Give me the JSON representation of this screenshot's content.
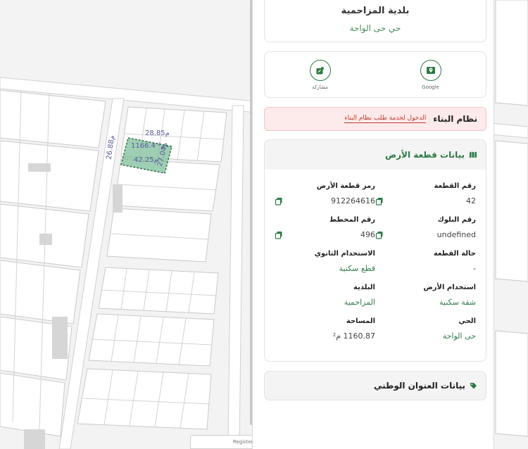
{
  "municipality": {
    "title": "بلدية المزاحمية",
    "district": "حي حى الواحة"
  },
  "actions": [
    {
      "label": "Google",
      "icon": "map-pin-icon"
    },
    {
      "label": "مشاركة",
      "icon": "share-icon"
    }
  ],
  "building_system": {
    "title": "نظام البناء",
    "link": "الدخول لخدمة طلب نظام البناء"
  },
  "land": {
    "title": "بيانات قطعة الأرض",
    "fields": [
      {
        "label": "رقم القطعة",
        "value": "42",
        "copy": true
      },
      {
        "label": "رمز قطعة الأرض",
        "value": "912264616",
        "copy": true
      },
      {
        "label": "رقم البلوك",
        "value": "undefined",
        "copy": true
      },
      {
        "label": "رقم المخطط",
        "value": "496",
        "copy": true
      },
      {
        "label": "حالة القطعة",
        "value": "-",
        "copy": false
      },
      {
        "label": "الاستخدام الثانوي",
        "value": "قطع سكنية",
        "copy": false
      },
      {
        "label": "استخدام الأرض",
        "value": "شقة سكنية",
        "copy": false
      },
      {
        "label": "البلدية",
        "value": "المزاحمية",
        "copy": false
      },
      {
        "label": "الحي",
        "value": "حى الواحة",
        "copy": false
      },
      {
        "label": "المساحة",
        "value": "1160.87 م²",
        "copy": false
      }
    ]
  },
  "national_address": {
    "title": "بيانات العنوان الوطني"
  },
  "map": {
    "dims": {
      "top": "28.85م",
      "left": "26.88م",
      "bottom": "42.25م",
      "right": "27.04م",
      "area": "1166.4 م²"
    },
    "scale_label": "Registered on"
  },
  "colors": {
    "accent": "#2c7a44",
    "parcel": "#7fbf9a"
  }
}
